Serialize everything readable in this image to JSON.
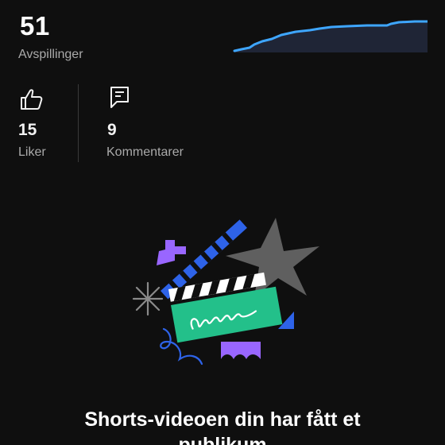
{
  "views": {
    "value": "51",
    "label": "Avspillinger"
  },
  "stats": [
    {
      "icon": "thumbs-up-icon",
      "value": "15",
      "label": "Liker"
    },
    {
      "icon": "comment-icon",
      "value": "9",
      "label": "Kommentarer"
    }
  ],
  "colors": {
    "background": "#0f0f0f",
    "sparkline": "#3ea6ff",
    "sparkline_fill": "#1f2536",
    "clapper_green": "#23c08a",
    "star_gray": "#5f5f5f",
    "purple": "#9966ff",
    "blue": "#2e63e8"
  },
  "illustration_icon": "clapperboard-illustration",
  "headline": "Shorts-videoen din har fått et publikum"
}
